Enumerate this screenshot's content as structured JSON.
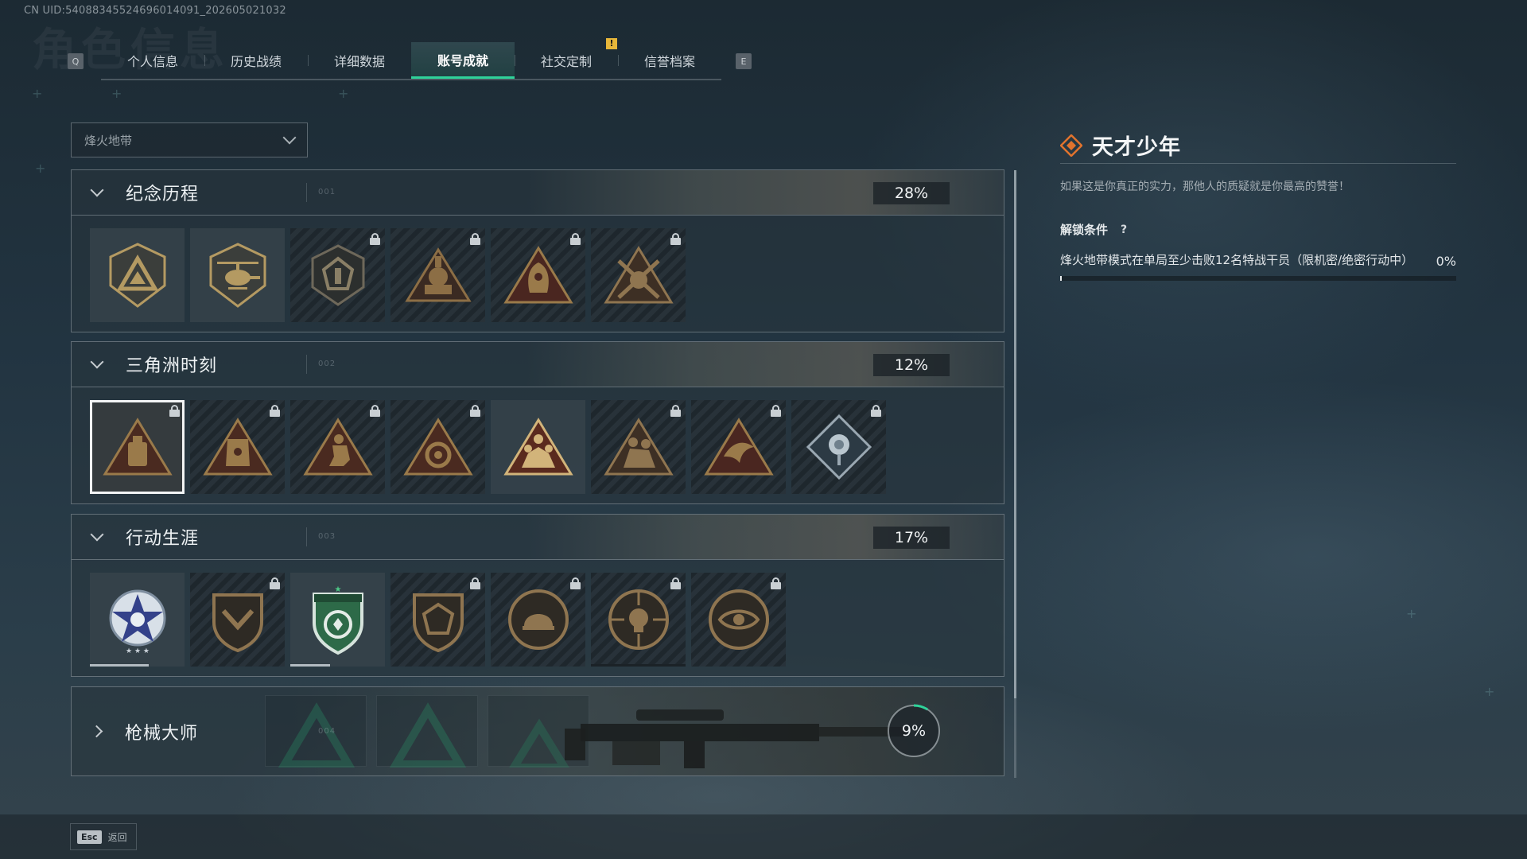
{
  "uid": "CN UID:540883455246960140​91_202605021032",
  "ghost_title": "角色信息",
  "tabbar": {
    "left_key": "Q",
    "right_key": "E",
    "tabs": [
      {
        "label": "个人信息",
        "active": false
      },
      {
        "label": "历史战绩",
        "active": false
      },
      {
        "label": "详细数据",
        "active": false
      },
      {
        "label": "账号成就",
        "active": true
      },
      {
        "label": "社交定制",
        "active": false
      },
      {
        "label": "信誉档案",
        "active": false
      }
    ],
    "alert_mark": "!"
  },
  "mode_select": {
    "value": "烽火地带"
  },
  "categories": [
    {
      "name": "纪念历程",
      "index": "001",
      "percent": "28%"
    },
    {
      "name": "三角洲时刻",
      "index": "002",
      "percent": "12%"
    },
    {
      "name": "行动生涯",
      "index": "003",
      "percent": "17%"
    },
    {
      "name": "枪械大师",
      "index": "004",
      "percent": "9%",
      "progress": 0.09
    }
  ],
  "detail": {
    "title": "天才少年",
    "description": "如果这是你真正的实力，那他人的质疑就是你最高的赞誉！",
    "condition_label": "解锁条件",
    "help_glyph": "?",
    "condition_text": "烽火地带模式在单局至少击败12名特战干员（限机密/绝密行动中）",
    "condition_percent": "0%",
    "condition_progress": 0
  },
  "footer": {
    "esc_key": "Esc",
    "esc_label": "返回"
  },
  "colors": {
    "accent": "#2fd39a",
    "alert": "#e8b73a",
    "badge_gold": "#b49a62",
    "badge_red": "#8c2f22",
    "diamond": "#e0732d"
  }
}
